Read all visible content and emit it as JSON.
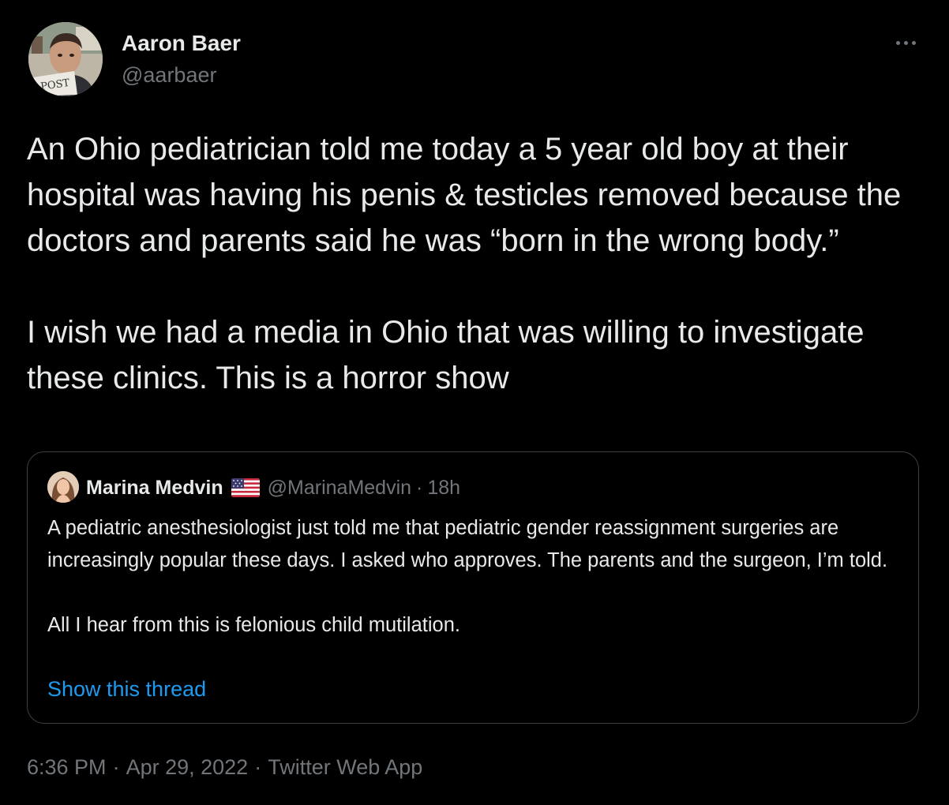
{
  "tweet": {
    "author": {
      "name": "Aaron Baer",
      "handle": "@aarbaer",
      "avatar_caption": "POST"
    },
    "more_icon": "more-horizontal-icon",
    "text": "An Ohio pediatrician told me today a 5 year old boy at their hospital was having his penis & testicles removed because the doctors and parents said he was “born in the wrong body.”\n\nI wish we had a media in Ohio that was willing to investigate these clinics. This is a horror show",
    "quoted": {
      "name": "Marina Medvin",
      "flag_icon": "us-flag-icon",
      "handle": "@MarinaMedvin",
      "separator": "·",
      "time": "18h",
      "text": "A pediatric anesthesiologist just told me that pediatric gender reassignment surgeries are increasingly popular these days. I asked who approves. The parents and the surgeon, I’m told.\n\nAll I hear from this is felonious child mutilation.",
      "show_thread": "Show this thread"
    },
    "meta": {
      "time": "6:36 PM",
      "separator": "·",
      "date": "Apr 29, 2022",
      "source": "Twitter Web App"
    }
  },
  "colors": {
    "background": "#000000",
    "text_primary": "#e7e9ea",
    "text_secondary": "#71767b",
    "link": "#1d9bf0",
    "border": "#3e4144"
  }
}
